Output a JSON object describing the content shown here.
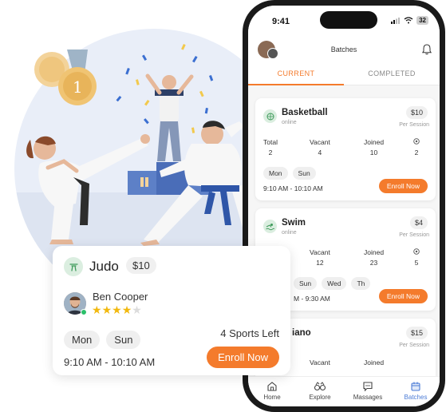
{
  "phone": {
    "status_time": "9:41",
    "battery": "32",
    "header_title": "Batches",
    "tabs": [
      {
        "label": "CURRENT",
        "active": true
      },
      {
        "label": "COMPLETED",
        "active": false
      }
    ],
    "batches": [
      {
        "name": "Basketball",
        "mode": "online",
        "price": "$10",
        "price_unit": "Per Session",
        "stats": [
          {
            "label": "Total",
            "value": "2"
          },
          {
            "label": "Vacant",
            "value": "4"
          },
          {
            "label": "Joined",
            "value": "10"
          },
          {
            "label": "",
            "value": "2"
          }
        ],
        "days": [
          "Mon",
          "Sun"
        ],
        "time": "9:10 AM - 10:10 AM",
        "enroll_label": "Enroll Now"
      },
      {
        "name": "Swim",
        "mode": "online",
        "price": "$4",
        "price_unit": "Per Session",
        "stats": [
          {
            "label": "",
            "value": ""
          },
          {
            "label": "Vacant",
            "value": "12"
          },
          {
            "label": "Joined",
            "value": "23"
          },
          {
            "label": "",
            "value": "5"
          }
        ],
        "days": [
          "Sun",
          "Wed",
          "Th"
        ],
        "time": "M - 9:30 AM",
        "enroll_label": "Enroll Now"
      },
      {
        "name": "iano",
        "mode": "",
        "price": "$15",
        "price_unit": "Per Session",
        "stats": [
          {
            "label": "",
            "value": ""
          },
          {
            "label": "Vacant",
            "value": ""
          },
          {
            "label": "Joined",
            "value": ""
          },
          {
            "label": "",
            "value": ""
          }
        ],
        "days": [],
        "time": "",
        "enroll_label": ""
      }
    ],
    "nav": [
      {
        "label": "Home",
        "icon": "home-icon",
        "active": false
      },
      {
        "label": "Explore",
        "icon": "binoculars-icon",
        "active": false
      },
      {
        "label": "Massages",
        "icon": "chat-icon",
        "active": false
      },
      {
        "label": "Batches",
        "icon": "calendar-icon",
        "active": true
      }
    ]
  },
  "judo_card": {
    "sport": "Judo",
    "price": "$10",
    "coach": "Ben Cooper",
    "rating": 4,
    "rating_max": 5,
    "days": [
      "Mon",
      "Sun"
    ],
    "time": "9:10 AM - 10:10 AM",
    "sports_left": "4 Sports Left",
    "enroll_label": "Enroll Now"
  },
  "colors": {
    "accent": "#f47b2c",
    "nav_active": "#4b7bd6",
    "online": "#2bc06a",
    "star": "#f2b90f",
    "gi_belt": "#2f56a8"
  }
}
